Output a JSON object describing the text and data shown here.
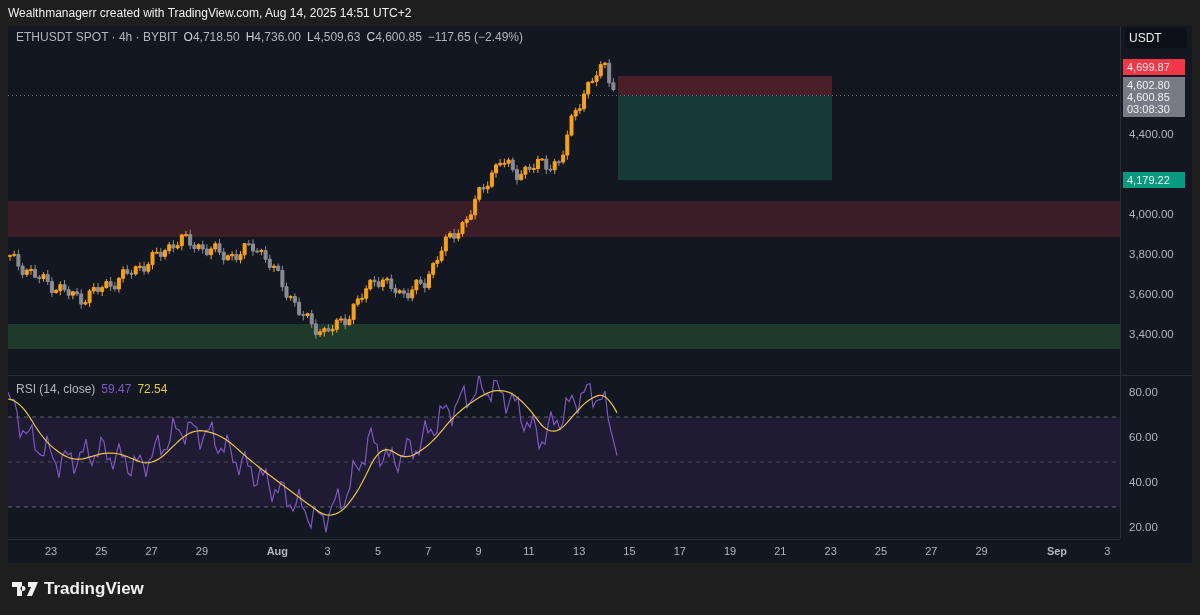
{
  "credit": "Wealthmanagerr created with TradingView.com, Aug 14, 2025 14:51 UTC+2",
  "legend": {
    "title": "ETHUSDT SPOT · 4h · BYBIT",
    "values": [
      {
        "letter": "O",
        "value": "4,718.50"
      },
      {
        "letter": "H",
        "value": "4,736.00"
      },
      {
        "letter": "L",
        "value": "4,509.63"
      },
      {
        "letter": "C",
        "value": "4,600.85"
      }
    ],
    "change": "−117.65 (−2.49%)"
  },
  "price_axis": {
    "currency": "USDT",
    "ticks": [
      "4,400.00",
      "4,000.00",
      "3,800.00",
      "3,600.00",
      "3,400.00"
    ],
    "badges": [
      {
        "lines": [
          "4,699.87"
        ],
        "color": "#f23645"
      },
      {
        "lines": [
          "4,602.80",
          "4,600.85",
          "03:08:30"
        ],
        "color": "#787b86"
      },
      {
        "lines": [
          "4,179.22"
        ],
        "color": "#089981"
      }
    ]
  },
  "rsi": {
    "title": "RSI (14, close)",
    "values": [
      {
        "value": "59.47",
        "color": "#7e57c2"
      },
      {
        "value": "72.54",
        "color": "#e8c547"
      }
    ],
    "ticks": [
      "80.00",
      "60.00",
      "40.00",
      "20.00"
    ]
  },
  "time_axis": [
    {
      "label": "23",
      "bold": false
    },
    {
      "label": "25",
      "bold": false
    },
    {
      "label": "27",
      "bold": false
    },
    {
      "label": "29",
      "bold": false
    },
    {
      "label": "Aug",
      "bold": true
    },
    {
      "label": "3",
      "bold": false
    },
    {
      "label": "5",
      "bold": false
    },
    {
      "label": "7",
      "bold": false
    },
    {
      "label": "9",
      "bold": false
    },
    {
      "label": "11",
      "bold": false
    },
    {
      "label": "13",
      "bold": false
    },
    {
      "label": "15",
      "bold": false
    },
    {
      "label": "17",
      "bold": false
    },
    {
      "label": "19",
      "bold": false
    },
    {
      "label": "21",
      "bold": false
    },
    {
      "label": "23",
      "bold": false
    },
    {
      "label": "25",
      "bold": false
    },
    {
      "label": "27",
      "bold": false
    },
    {
      "label": "29",
      "bold": false
    },
    {
      "label": "Sep",
      "bold": true
    },
    {
      "label": "3",
      "bold": false
    }
  ],
  "brand": "TradingView"
}
